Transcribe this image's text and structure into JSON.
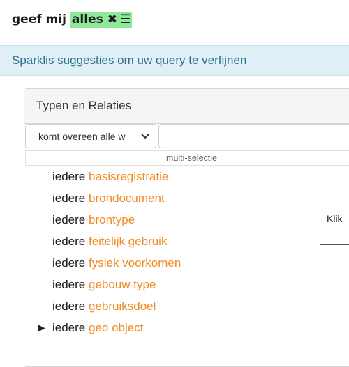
{
  "query": {
    "prefix": "geef mij",
    "focus_label": "alles",
    "delete_icon": "close-x-icon",
    "menu_icon": "hamburger-menu-icon",
    "focus_color": "#8fe89a"
  },
  "suggestions": {
    "header": "Sparklis suggesties om uw query te verfijnen"
  },
  "panel": {
    "title": "Typen en Relaties",
    "match_select_value": "komt overeen alle w",
    "filter_value": "",
    "multi_select_label": "multi-selectie",
    "items": [
      {
        "quantifier": "iedere",
        "concept": "basisregistratie",
        "expandable": false
      },
      {
        "quantifier": "iedere",
        "concept": "brondocument",
        "expandable": false
      },
      {
        "quantifier": "iedere",
        "concept": "brontype",
        "expandable": false
      },
      {
        "quantifier": "iedere",
        "concept": "feitelijk gebruik",
        "expandable": false
      },
      {
        "quantifier": "iedere",
        "concept": "fysiek voorkomen",
        "expandable": false
      },
      {
        "quantifier": "iedere",
        "concept": "gebouw type",
        "expandable": false
      },
      {
        "quantifier": "iedere",
        "concept": "gebruiksdoel",
        "expandable": false
      },
      {
        "quantifier": "iedere",
        "concept": "geo object",
        "expandable": true
      }
    ]
  },
  "tooltip": {
    "text": "Klik"
  },
  "colors": {
    "concept": "#f28a24",
    "header_bg": "#dff0f7",
    "header_text": "#2e6f8d"
  }
}
